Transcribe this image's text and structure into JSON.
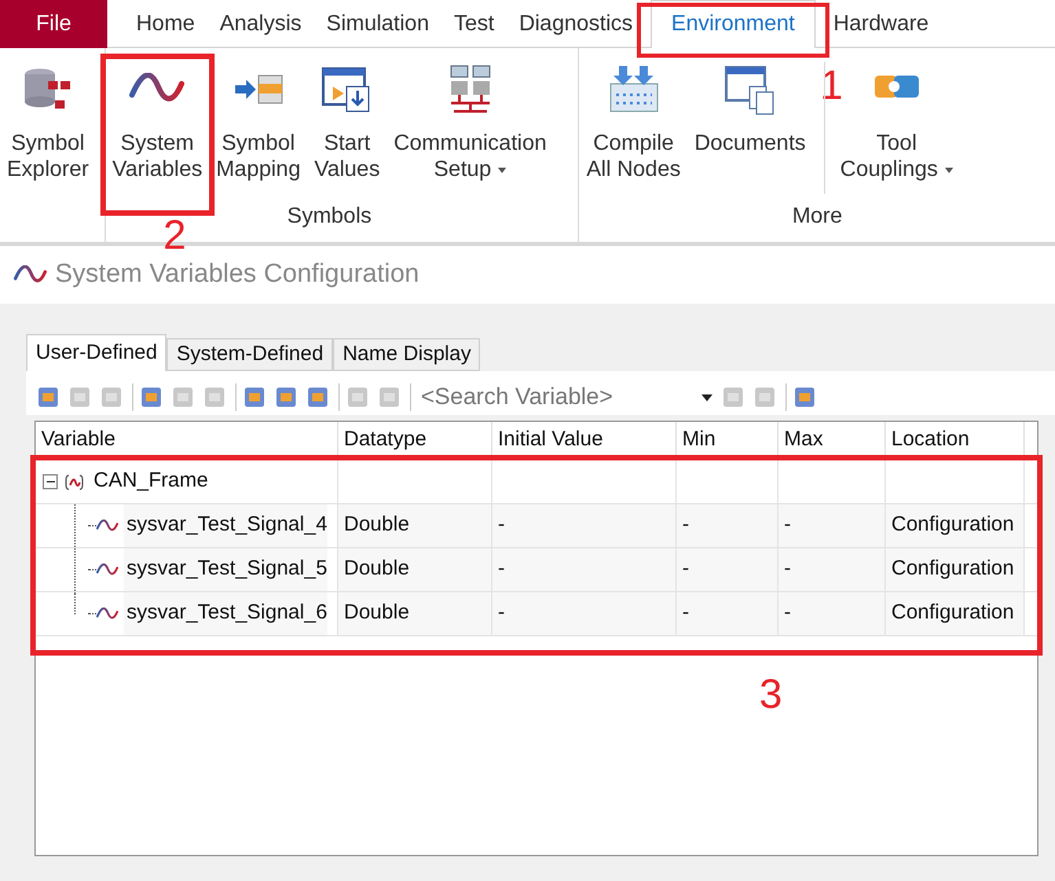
{
  "file_menu": {
    "label": "File"
  },
  "menu_tabs": [
    {
      "label": "Home",
      "selected": false
    },
    {
      "label": "Analysis",
      "selected": false
    },
    {
      "label": "Simulation",
      "selected": false
    },
    {
      "label": "Test",
      "selected": false
    },
    {
      "label": "Diagnostics",
      "selected": false
    },
    {
      "label": "Environment",
      "selected": true,
      "annotation": "1"
    },
    {
      "label": "Hardware",
      "selected": false
    }
  ],
  "ribbon_groups": [
    {
      "buttons": [
        {
          "label": "Symbol\nExplorer"
        }
      ]
    },
    {
      "label": "Symbols",
      "buttons": [
        {
          "label": "System\nVariables",
          "annotation": "2"
        },
        {
          "label": "Symbol\nMapping"
        },
        {
          "label": "Start\nValues"
        },
        {
          "label": "Communication\nSetup",
          "dropdown": true
        }
      ]
    },
    {
      "label": "More",
      "buttons": [
        {
          "label": "Compile\nAll Nodes"
        },
        {
          "label": "Documents"
        },
        {
          "label": "Tool\nCouplings",
          "dropdown": true,
          "separator_before": true
        }
      ]
    }
  ],
  "panel": {
    "title": "System Variables Configuration",
    "tabs": [
      {
        "label": "User-Defined",
        "selected": true
      },
      {
        "label": "System-Defined",
        "selected": false
      },
      {
        "label": "Name Display",
        "selected": false
      }
    ],
    "search": {
      "placeholder": "<Search Variable>"
    },
    "table": {
      "columns": [
        "Variable",
        "Datatype",
        "Initial Value",
        "Min",
        "Max",
        "Location"
      ],
      "annotation": "3",
      "rows": [
        {
          "cells": [
            "CAN_Frame",
            "",
            "",
            "",
            "",
            ""
          ],
          "expanded": true,
          "children": [
            {
              "cells": [
                "sysvar_Test_Signal_4",
                "Double",
                "-",
                "-",
                "-",
                "Configuration"
              ]
            },
            {
              "cells": [
                "sysvar_Test_Signal_5",
                "Double",
                "-",
                "-",
                "-",
                "Configuration"
              ]
            },
            {
              "cells": [
                "sysvar_Test_Signal_6",
                "Double",
                "-",
                "-",
                "-",
                "Configuration"
              ]
            }
          ]
        }
      ]
    }
  }
}
